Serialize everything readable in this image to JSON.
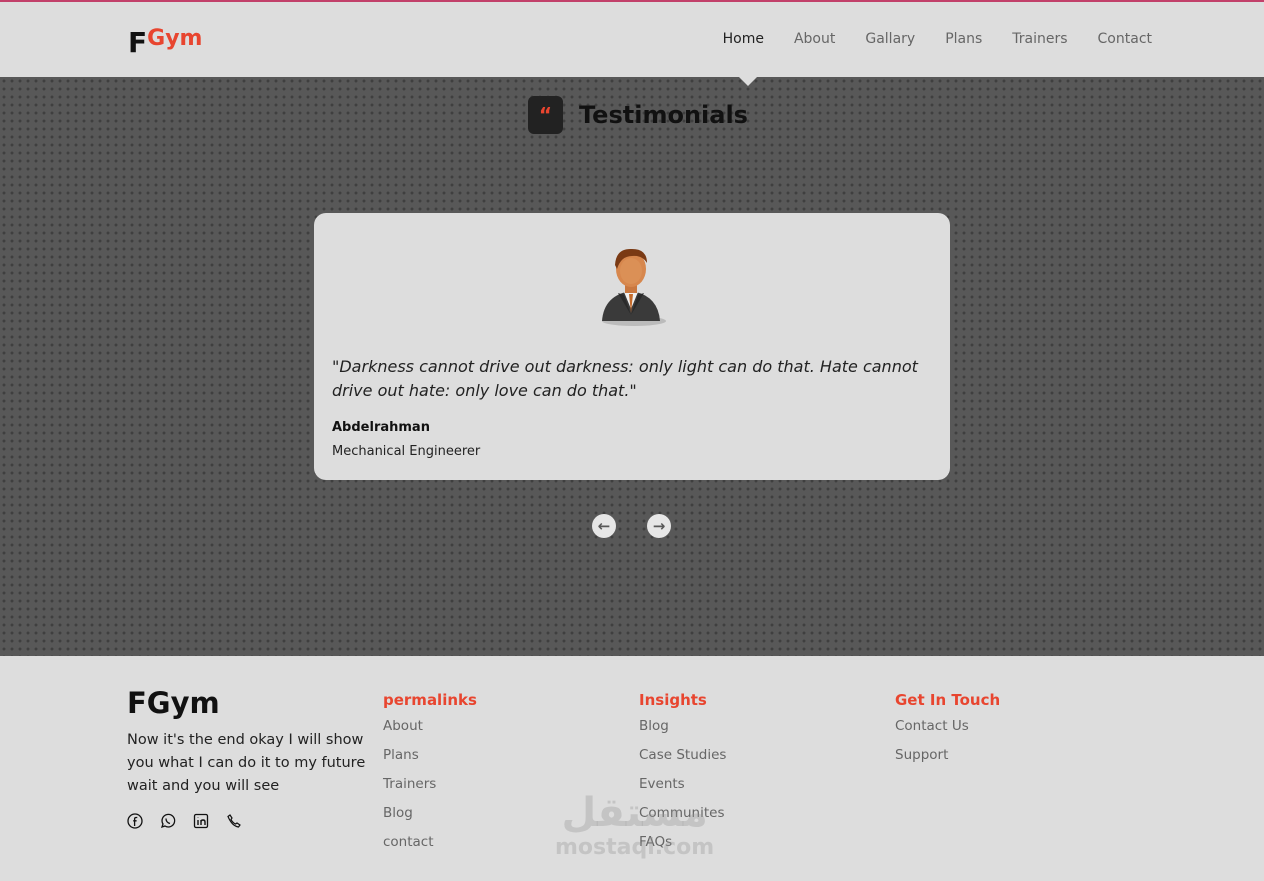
{
  "header": {
    "logo_big": "F",
    "logo_small": "Gym",
    "nav": [
      {
        "label": "Home",
        "active": true
      },
      {
        "label": "About"
      },
      {
        "label": "Gallary"
      },
      {
        "label": "Plans"
      },
      {
        "label": "Trainers"
      },
      {
        "label": "Contact"
      }
    ]
  },
  "testimonials": {
    "title": "Testimonials",
    "quote_glyph": "“",
    "quote": "\"Darkness cannot drive out darkness: only light can do that. Hate cannot drive out hate: only love can do that.\"",
    "name": "Abdelrahman",
    "role": "Mechanical Engineerer",
    "prev_glyph": "←",
    "next_glyph": "→"
  },
  "footer": {
    "brand": "FGym",
    "about": "Now it's the end okay I will show you what I can do it to my future wait and you will see",
    "socials": [
      "facebook-icon",
      "whatsapp-icon",
      "linkedin-icon",
      "phone-icon"
    ],
    "columns": [
      {
        "title": "permalinks",
        "links": [
          "About",
          "Plans",
          "Trainers",
          "Blog",
          "contact"
        ]
      },
      {
        "title": "Insights",
        "links": [
          "Blog",
          "Case Studies",
          "Events",
          "Communites",
          "FAQs"
        ]
      },
      {
        "title": "Get In Touch",
        "links": [
          "Contact Us",
          "Support"
        ]
      }
    ],
    "watermark_ar": "مستقل",
    "watermark_en": "mostaql.com"
  },
  "colors": {
    "accent": "#e8452f",
    "section_bg": "#585858",
    "light_bg": "#dddddd"
  }
}
